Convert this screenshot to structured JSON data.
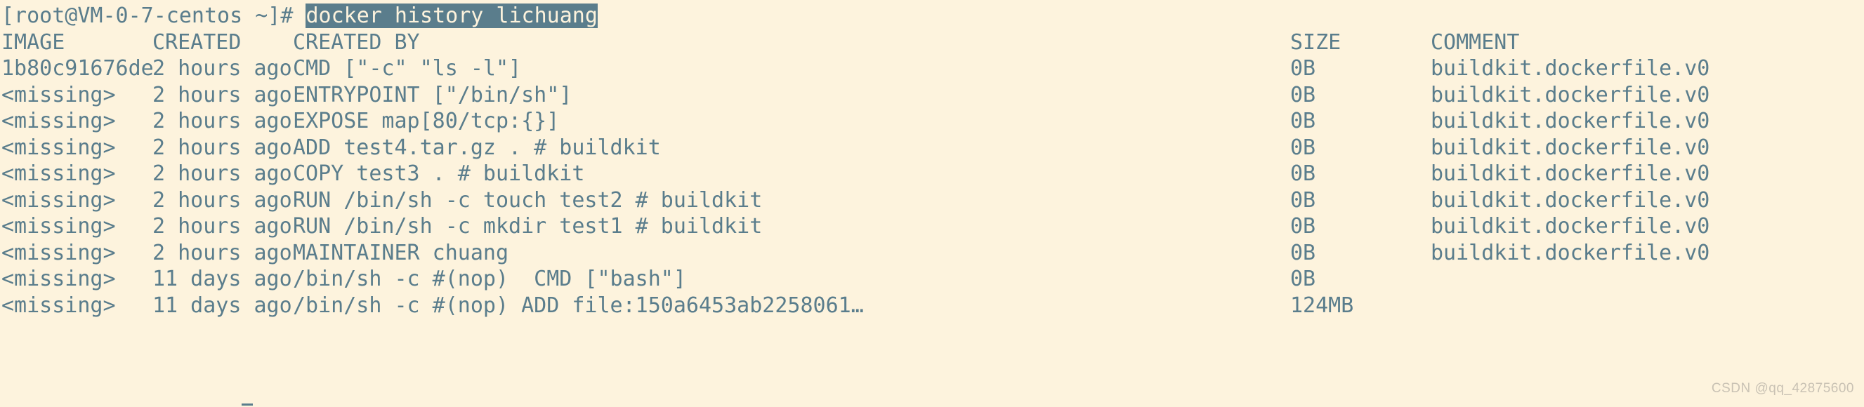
{
  "terminal": {
    "background_color": "#fdf3dd",
    "foreground_color": "#5a7d8c",
    "selection_background": "#5a7d8c",
    "selection_foreground": "#fdf3dd",
    "prompt": "[root@VM-0-7-centos ~]# ",
    "command": "docker history lichuang",
    "command_selected": true
  },
  "table": {
    "headers": {
      "image": "IMAGE",
      "created": "CREATED",
      "created_by": "CREATED BY",
      "size": "SIZE",
      "comment": "COMMENT"
    },
    "rows": [
      {
        "image": "1b80c91676de",
        "created": "2 hours ago",
        "created_by": "CMD [\"-c\" \"ls -l\"]",
        "size": "0B",
        "comment": "buildkit.dockerfile.v0"
      },
      {
        "image": "<missing>",
        "created": "2 hours ago",
        "created_by": "ENTRYPOINT [\"/bin/sh\"]",
        "size": "0B",
        "comment": "buildkit.dockerfile.v0"
      },
      {
        "image": "<missing>",
        "created": "2 hours ago",
        "created_by": "EXPOSE map[80/tcp:{}]",
        "size": "0B",
        "comment": "buildkit.dockerfile.v0"
      },
      {
        "image": "<missing>",
        "created": "2 hours ago",
        "created_by": "ADD test4.tar.gz . # buildkit",
        "size": "0B",
        "comment": "buildkit.dockerfile.v0"
      },
      {
        "image": "<missing>",
        "created": "2 hours ago",
        "created_by": "COPY test3 . # buildkit",
        "size": "0B",
        "comment": "buildkit.dockerfile.v0"
      },
      {
        "image": "<missing>",
        "created": "2 hours ago",
        "created_by": "RUN /bin/sh -c touch test2 # buildkit",
        "size": "0B",
        "comment": "buildkit.dockerfile.v0"
      },
      {
        "image": "<missing>",
        "created": "2 hours ago",
        "created_by": "RUN /bin/sh -c mkdir test1 # buildkit",
        "size": "0B",
        "comment": "buildkit.dockerfile.v0"
      },
      {
        "image": "<missing>",
        "created": "2 hours ago",
        "created_by": "MAINTAINER chuang",
        "size": "0B",
        "comment": "buildkit.dockerfile.v0"
      },
      {
        "image": "<missing>",
        "created": "11 days ago",
        "created_by": "/bin/sh -c #(nop)  CMD [\"bash\"]",
        "size": "0B",
        "comment": ""
      },
      {
        "image": "<missing>",
        "created": "11 days ago",
        "created_by": "/bin/sh -c #(nop) ADD file:150a6453ab2258061…",
        "size": "124MB",
        "comment": ""
      }
    ]
  },
  "watermark": {
    "text": "CSDN @qq_42875600"
  }
}
